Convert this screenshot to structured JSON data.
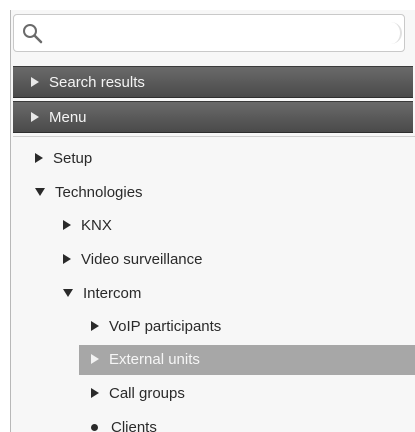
{
  "search": {
    "placeholder": "",
    "value": ""
  },
  "sections": {
    "search_results": "Search results",
    "menu": "Menu"
  },
  "tree": {
    "setup": "Setup",
    "technologies": "Technologies",
    "knx": "KNX",
    "video_surveillance": "Video surveillance",
    "intercom": "Intercom",
    "voip_participants": "VoIP participants",
    "external_units": "External units",
    "call_groups": "Call groups",
    "clients": "Clients"
  },
  "icons": {
    "search": "search-icon",
    "collapsed": "triangle-right-icon",
    "expanded": "triangle-down-icon",
    "leaf": "bullet-icon"
  },
  "colors": {
    "header_bg": "#555555",
    "selected_bg": "#a7a7a7",
    "panel_bg": "#f7f7f7"
  }
}
